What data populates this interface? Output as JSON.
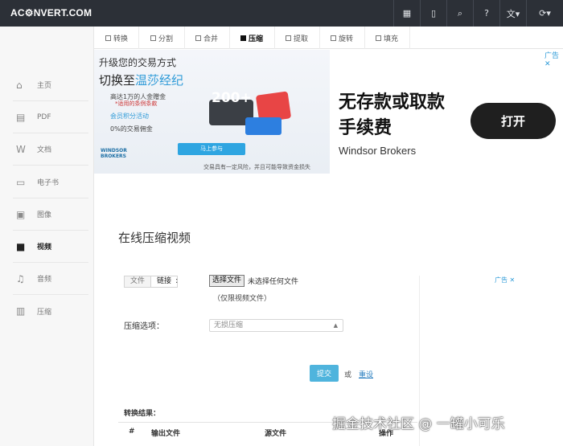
{
  "header": {
    "logo": "AC⚙NVERT.COM",
    "icons": [
      "grid-icon",
      "tablet-icon",
      "search-icon",
      "help-icon",
      "language-icon",
      "refresh-icon"
    ]
  },
  "sidebar": {
    "items": [
      {
        "label": "主页",
        "icon": "home-icon"
      },
      {
        "label": "PDF",
        "icon": "pdf-icon"
      },
      {
        "label": "文档",
        "icon": "word-icon"
      },
      {
        "label": "电子书",
        "icon": "ebook-icon"
      },
      {
        "label": "图像",
        "icon": "image-icon"
      },
      {
        "label": "视频",
        "icon": "video-icon"
      },
      {
        "label": "音频",
        "icon": "audio-icon"
      },
      {
        "label": "压缩",
        "icon": "archive-icon"
      }
    ],
    "active": "视频"
  },
  "tabs": [
    "转换",
    "分割",
    "合并",
    "压缩",
    "提取",
    "旋转",
    "填充"
  ],
  "active_tab": "压缩",
  "ad_top": {
    "headline1": "升级您的交易方式",
    "headline2_a": "切换至",
    "headline2_b": "温莎经纪",
    "line1": "高达1万的人金赠金",
    "note": "*适用的条例条款",
    "line2": "会员积分活动",
    "line3": "0%的交易佣金",
    "banner_number": "200+",
    "cta_small": "马上参与",
    "brand_logo": "WINDSOR BROKERS",
    "risk": "交易具有一定风险，并且可能导致资金损失",
    "title1": "无存款或取款",
    "title2": "手续费",
    "company": "Windsor Brokers",
    "open_button": "打开",
    "adchoices": "广告 ✕"
  },
  "main": {
    "page_title": "在线压缩视频",
    "file_tab": "文件",
    "link_tab": "链接",
    "colon": ":",
    "choose_file": "选择文件",
    "no_file": "未选择任何文件",
    "video_only": "（仅限视频文件）",
    "options_label": "压缩选项：",
    "options_value": "无损压缩",
    "submit": "提交",
    "or": "或",
    "reset": "重设",
    "ad_label": "广告 ✕",
    "results_label": "转换结果：",
    "table_headers": [
      "#",
      "输出文件",
      "源文件",
      "操作"
    ]
  },
  "watermark": "掘金技术社区 @ 一罐小可乐"
}
